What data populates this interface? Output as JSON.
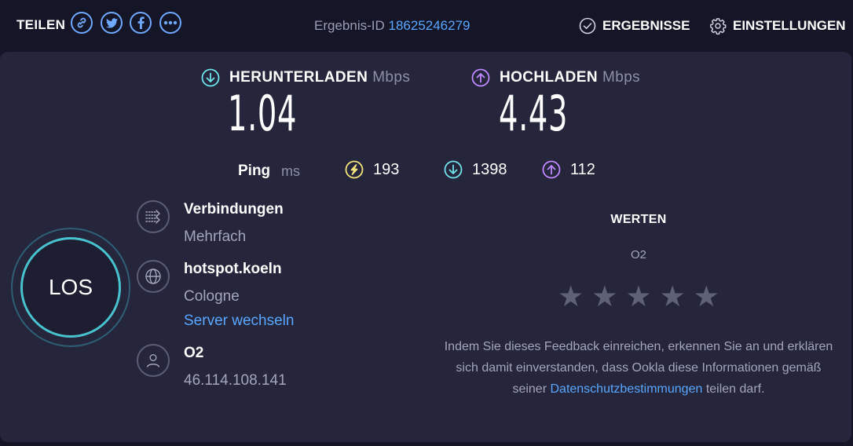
{
  "header": {
    "share_label": "TEILEN",
    "share_icons": [
      "link-icon",
      "twitter-icon",
      "facebook-icon",
      "more-icon"
    ],
    "result_id_label": "Ergebnis-ID",
    "result_id_value": "18625246279",
    "results_label": "ERGEBNISSE",
    "settings_label": "EINSTELLUNGEN"
  },
  "download": {
    "label": "HERUNTERLADEN",
    "unit": "Mbps",
    "value": "1.04",
    "icon": "arrow-down-circle-icon",
    "color": "#6fe2ea"
  },
  "upload": {
    "label": "HOCHLADEN",
    "unit": "Mbps",
    "value": "4.43",
    "icon": "arrow-up-circle-icon",
    "color": "#bf88ff"
  },
  "ping": {
    "label": "Ping",
    "unit": "ms",
    "idle": "193",
    "download": "1398",
    "upload": "112",
    "idle_color": "#f3e27b"
  },
  "go_button": {
    "label": "LOS"
  },
  "connections": {
    "title": "Verbindungen",
    "value": "Mehrfach"
  },
  "server": {
    "name": "hotspot.koeln",
    "location": "Cologne",
    "change_link": "Server wechseln"
  },
  "provider": {
    "name": "O2",
    "ip": "46.114.108.141"
  },
  "rating": {
    "title": "WERTEN",
    "isp": "O2",
    "stars": 5,
    "text_before": "Indem Sie dieses Feedback einreichen, erkennen Sie an und erklären sich damit einverstanden, dass Ookla diese Informationen gemäß seiner ",
    "privacy_link": "Datenschutzbestimmungen",
    "text_after": " teilen darf."
  },
  "colors": {
    "accent_link": "#5aa6ff",
    "background": "#141526",
    "panel": "#25263b"
  }
}
